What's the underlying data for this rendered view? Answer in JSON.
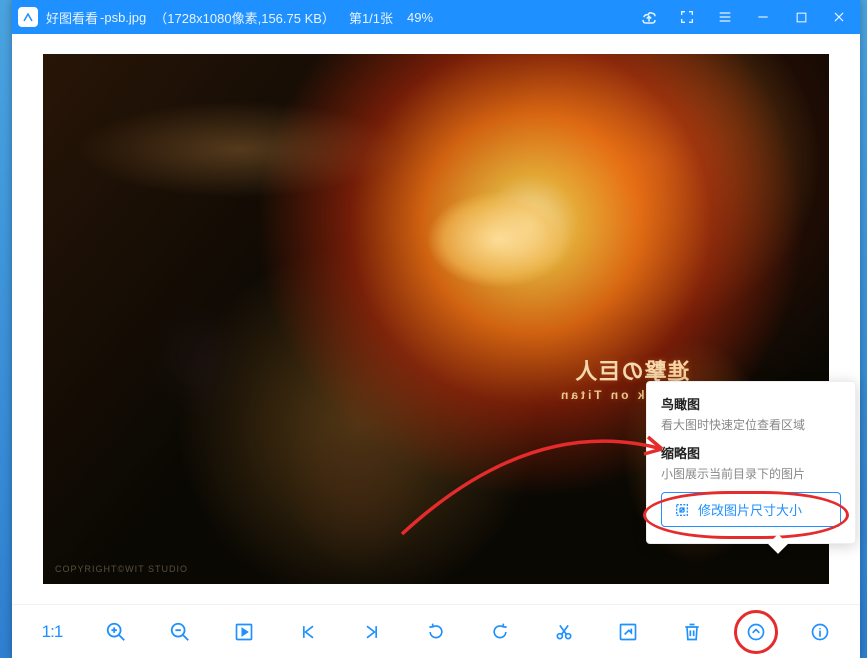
{
  "titlebar": {
    "app_name": "好图看看",
    "file_name": "-psb.jpg",
    "dimensions": "（1728x1080像素,156.75 KB）",
    "page_indicator": "第1/1张",
    "zoom": "49%"
  },
  "poster": {
    "title_cn": "進撃の巨人",
    "title_en": "Attack on Titan",
    "copyright": "COPYRIGHT©WIT STUDIO"
  },
  "toolbar": {
    "one_to_one": "1:1"
  },
  "popup": {
    "birdview_title": "鸟瞰图",
    "birdview_desc": "看大图时快速定位查看区域",
    "thumb_title": "缩略图",
    "thumb_desc": "小图展示当前目录下的图片",
    "resize_btn": "修改图片尺寸大小"
  }
}
